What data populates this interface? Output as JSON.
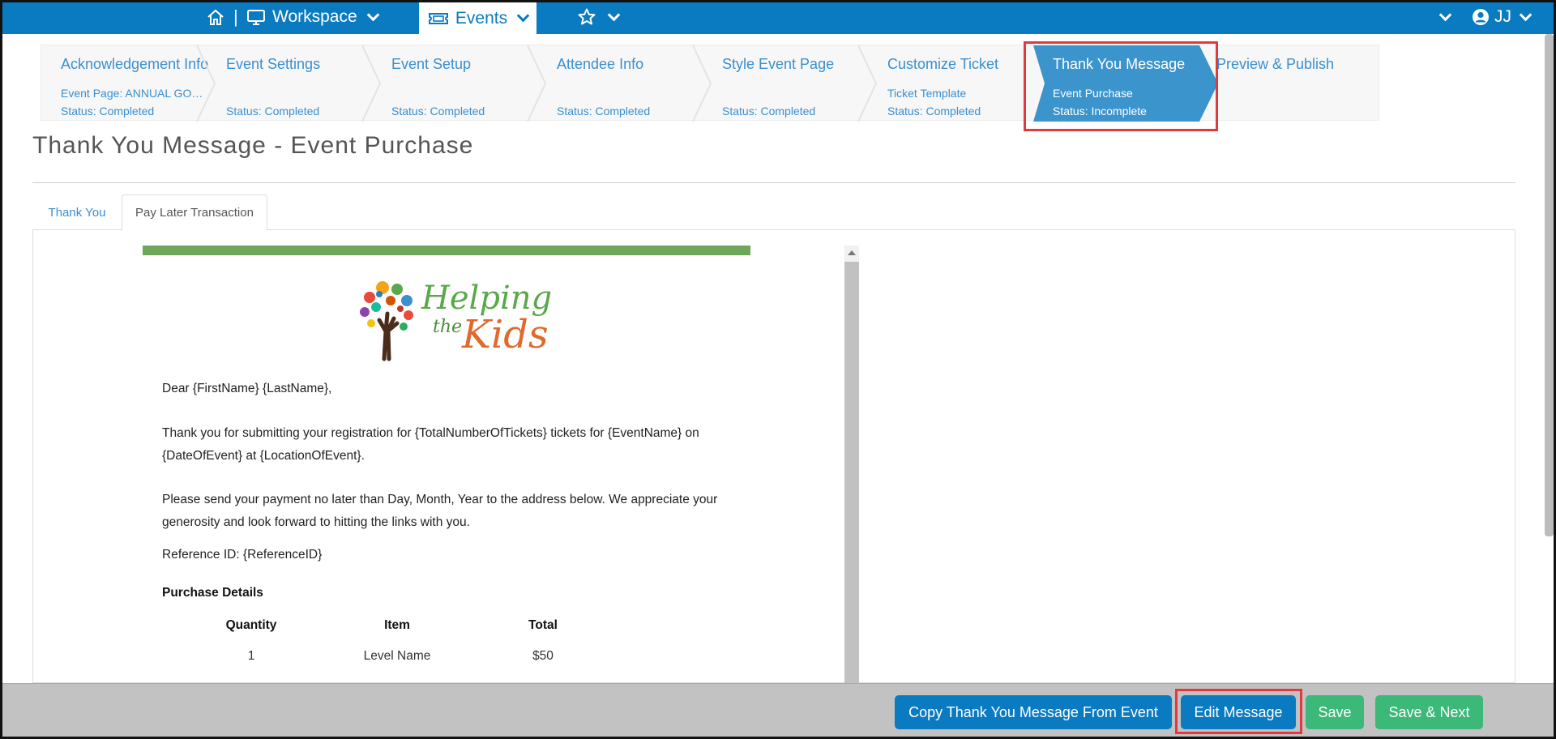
{
  "topbar": {
    "workspace_label": "Workspace",
    "events_label": "Events",
    "separator": "|",
    "user_initials": "JJ",
    "icons": [
      "home-icon",
      "monitor-icon",
      "ticket-icon",
      "star-icon",
      "user-circle-icon",
      "chevron-down-icon"
    ]
  },
  "wizard": {
    "steps": [
      {
        "title": "Acknowledgement Info",
        "sub": "Event Page: ANNUAL GOL…",
        "status": "Status: Completed"
      },
      {
        "title": "Event Settings",
        "sub": "",
        "status": "Status: Completed"
      },
      {
        "title": "Event Setup",
        "sub": "",
        "status": "Status: Completed"
      },
      {
        "title": "Attendee Info",
        "sub": "",
        "status": "Status: Completed"
      },
      {
        "title": "Style Event Page",
        "sub": "",
        "status": "Status: Completed"
      },
      {
        "title": "Customize Ticket",
        "sub": "Ticket Template",
        "status": "Status: Completed"
      },
      {
        "title": "Thank You Message",
        "sub": "Event Purchase",
        "status": "Status: Incomplete"
      },
      {
        "title": "Preview & Publish",
        "sub": "",
        "status": ""
      }
    ],
    "active_index": 6
  },
  "page": {
    "title": "Thank You Message - Event Purchase"
  },
  "tabs": [
    {
      "label": "Thank You",
      "active": false
    },
    {
      "label": "Pay Later Transaction",
      "active": true
    }
  ],
  "email": {
    "logo": {
      "helping": "Helping",
      "the": "the",
      "kids": "Kids"
    },
    "greeting": "Dear {FirstName} {LastName},",
    "para1": "Thank you for submitting your registration for {TotalNumberOfTickets} tickets for {EventName} on {DateOfEvent} at {LocationOfEvent}.",
    "para2": "Please send your payment no later than Day, Month, Year to the address below. We appreciate your generosity and look forward to hitting the links with you.",
    "reference": "Reference ID: {ReferenceID}",
    "purchase_heading": "Purchase Details",
    "table": {
      "headers": [
        "Quantity",
        "Item",
        "Total"
      ],
      "rows": [
        [
          "1",
          "Level Name",
          "$50"
        ]
      ]
    }
  },
  "footer": {
    "copy_label": "Copy Thank You Message From Event",
    "edit_label": "Edit Message",
    "save_label": "Save",
    "save_next_label": "Save & Next"
  },
  "colors": {
    "brand_blue": "#0a7bc0",
    "active_step": "#3c94cc",
    "save_green": "#3cb878",
    "highlight_red": "#e0393e",
    "email_bar_green": "#6ea65a"
  }
}
